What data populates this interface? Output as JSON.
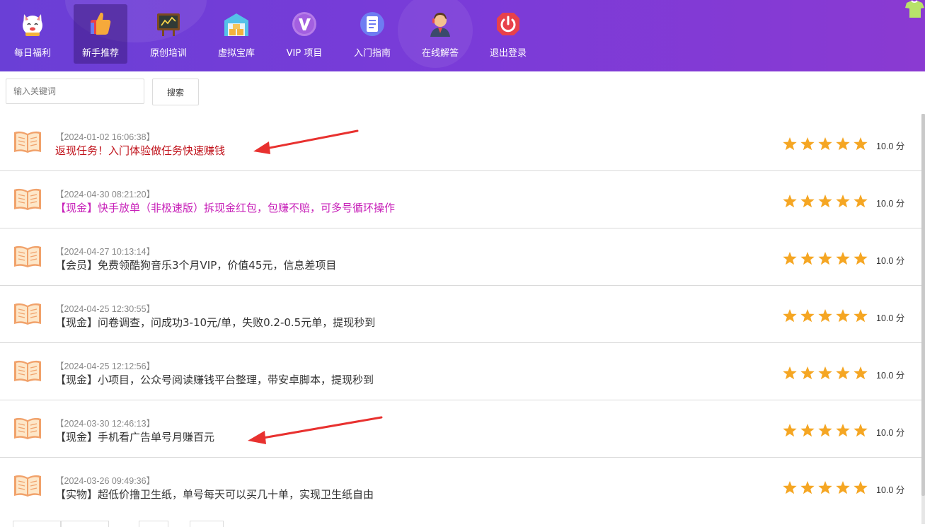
{
  "nav": {
    "items": [
      {
        "label": "每日福利",
        "icon": "lucky-cat-icon"
      },
      {
        "label": "新手推荐",
        "icon": "thumbs-up-icon",
        "active": true
      },
      {
        "label": "原创培训",
        "icon": "blackboard-icon"
      },
      {
        "label": "虚拟宝库",
        "icon": "warehouse-icon"
      },
      {
        "label": "VIP 项目",
        "icon": "vip-icon"
      },
      {
        "label": "入门指南",
        "icon": "document-icon"
      },
      {
        "label": "在线解答",
        "icon": "support-agent-icon"
      },
      {
        "label": "退出登录",
        "icon": "power-icon"
      }
    ]
  },
  "search": {
    "placeholder": "输入关键词",
    "button_label": "搜索"
  },
  "articles": [
    {
      "date": "【2024-01-02 16:06:38】",
      "title": "返现任务！入门体验做任务快速赚钱",
      "color": "#c0121b",
      "rating": 5,
      "score": "10.0 分"
    },
    {
      "date": "【2024-04-30 08:21:20】",
      "title": "【现金】快手放单（非极速版）拆现金红包，包赚不赔，可多号循环操作",
      "color": "#c71fb8",
      "rating": 5,
      "score": "10.0 分"
    },
    {
      "date": "【2024-04-27 10:13:14】",
      "title": "【会员】免费领酷狗音乐3个月VIP，价值45元，信息差项目",
      "color": "#333333",
      "rating": 5,
      "score": "10.0 分"
    },
    {
      "date": "【2024-04-25 12:30:55】",
      "title": "【现金】问卷调查，问成功3-10元/单，失败0.2-0.5元单，提现秒到",
      "color": "#333333",
      "rating": 5,
      "score": "10.0 分"
    },
    {
      "date": "【2024-04-25 12:12:56】",
      "title": "【现金】小项目，公众号阅读赚钱平台整理，带安卓脚本，提现秒到",
      "color": "#333333",
      "rating": 5,
      "score": "10.0 分"
    },
    {
      "date": "【2024-03-30 12:46:13】",
      "title": "【现金】手机看广告单号月赚百元",
      "color": "#333333",
      "rating": 5,
      "score": "10.0 分"
    },
    {
      "date": "【2024-03-26 09:49:36】",
      "title": "【实物】超低价撸卫生纸，单号每天可以买几十单，实现卫生纸自由",
      "color": "#333333",
      "rating": 5,
      "score": "10.0 分"
    }
  ],
  "colors": {
    "nav_gradient_start": "#6a3fd6",
    "nav_gradient_end": "#8a3ad2",
    "star": "#f5a623",
    "annotation_arrow": "#e8312f"
  }
}
